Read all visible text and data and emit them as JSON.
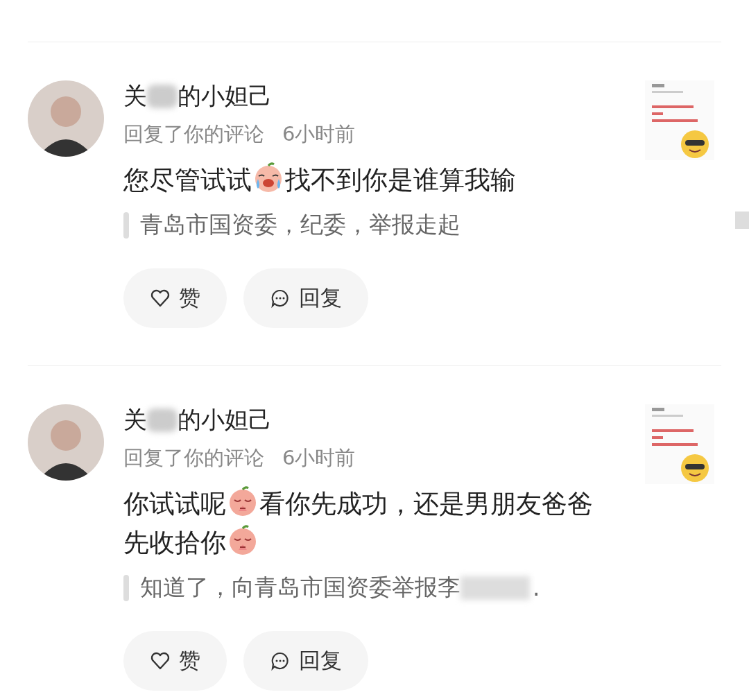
{
  "notifications": [
    {
      "name_start": "关",
      "name_end": "的小妲己",
      "action": "回复了你的评论",
      "time": "6小时前",
      "comment": [
        {
          "kind": "text",
          "text": "您尽管试试"
        },
        {
          "kind": "crying_emoji"
        },
        {
          "kind": "text",
          "text": "找不到你是谁算我输"
        }
      ],
      "quote_start": "青岛市国资委，纪委，举报走起",
      "like": "赞",
      "reply": "回复",
      "thumbnail": {
        "kind": "picture"
      }
    },
    {
      "name_start": "关",
      "name_end": "的小妲己",
      "action": "回复了你的评论",
      "time": "6小时前",
      "comment": [
        {
          "kind": "text",
          "text": "你试试呢"
        },
        {
          "kind": "pleading_emoji"
        },
        {
          "kind": "text",
          "text": "看你先成功，还是男朋友爸爸先收拾你"
        },
        {
          "kind": "pleading_emoji"
        }
      ],
      "quote_start": "知道了，向青岛市国资委举报李",
      "quote_end": ".",
      "like": "赞",
      "reply": "回复",
      "thumbnail": {
        "kind": "picture"
      }
    }
  ]
}
